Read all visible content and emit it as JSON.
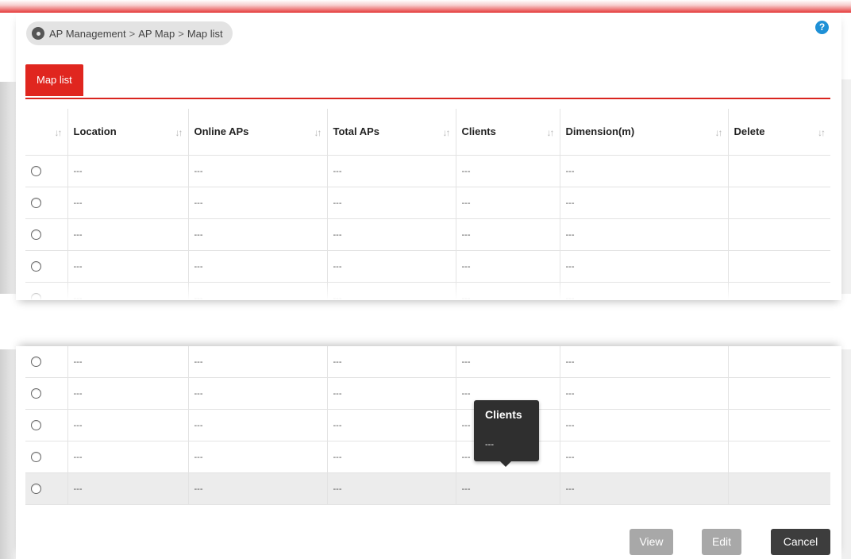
{
  "breadcrumb": {
    "items": [
      "AP Management",
      "AP Map",
      "Map list"
    ],
    "separator": ">"
  },
  "help_icon": "?",
  "tabs": [
    {
      "label": "Map list",
      "active": true
    }
  ],
  "table": {
    "columns": [
      "",
      "Location",
      "Online APs",
      "Total APs",
      "Clients",
      "Dimension(m)",
      "Delete"
    ],
    "sort_icon": "↓↑",
    "empty_value": "---"
  },
  "tooltip": {
    "title": "Clients",
    "value": "---"
  },
  "buttons": {
    "view": "View",
    "edit": "Edit",
    "cancel": "Cancel"
  },
  "colors": {
    "accent": "#e0261f",
    "help": "#1e90d6",
    "cancel": "#3d3d3d",
    "disabled": "#a8a8a8"
  }
}
